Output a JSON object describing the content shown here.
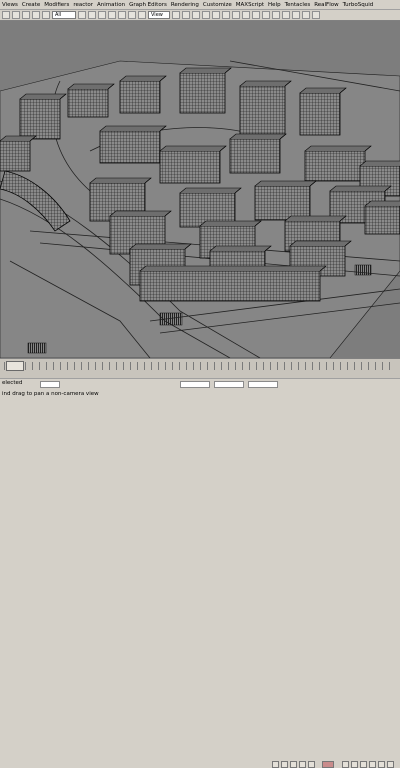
{
  "menu": [
    "Views",
    "Create",
    "Modifiers",
    "reactor",
    "Animation",
    "Graph Editors",
    "Rendering",
    "Customize",
    "MAXScript",
    "Help",
    "Tentacles",
    "RealFlow",
    "TurboSquid"
  ],
  "toolbar": {
    "selection_filter": "All",
    "reference_coord": "View"
  },
  "status": {
    "selected": "elected",
    "prompt": "ind drag to pan a non-camera view"
  }
}
